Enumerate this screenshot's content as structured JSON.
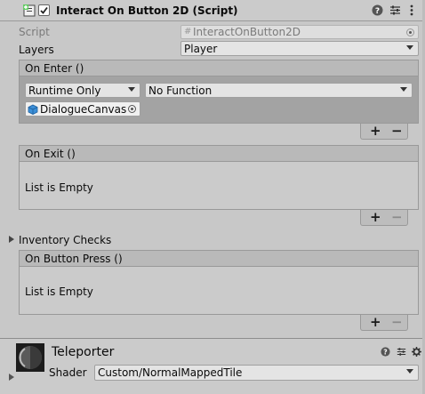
{
  "component": {
    "title": "Interact On Button 2D (Script)",
    "enabled": true,
    "script_label": "Script",
    "script_value": "InteractOnButton2D",
    "layers_label": "Layers",
    "layers_value": "Player"
  },
  "on_enter": {
    "header": "On Enter ()",
    "runtime": "Runtime Only",
    "function": "No Function",
    "target": "DialogueCanvas",
    "add": "+",
    "remove": "−"
  },
  "on_exit": {
    "header": "On Exit ()",
    "empty": "List is Empty",
    "add": "+",
    "remove": "−"
  },
  "inventory_checks": {
    "label": "Inventory Checks",
    "expanded": false
  },
  "on_button_press": {
    "header": "On Button Press ()",
    "empty": "List is Empty",
    "add": "+",
    "remove": "−"
  },
  "material": {
    "name": "Teleporter",
    "shader_label": "Shader",
    "shader_value": "Custom/NormalMappedTile"
  },
  "icons": [
    "script-component-icon",
    "help-icon",
    "presets-icon",
    "more-vert-icon",
    "object-picker-icon",
    "gameobject-cube-icon",
    "foldout-arrow-icon"
  ]
}
